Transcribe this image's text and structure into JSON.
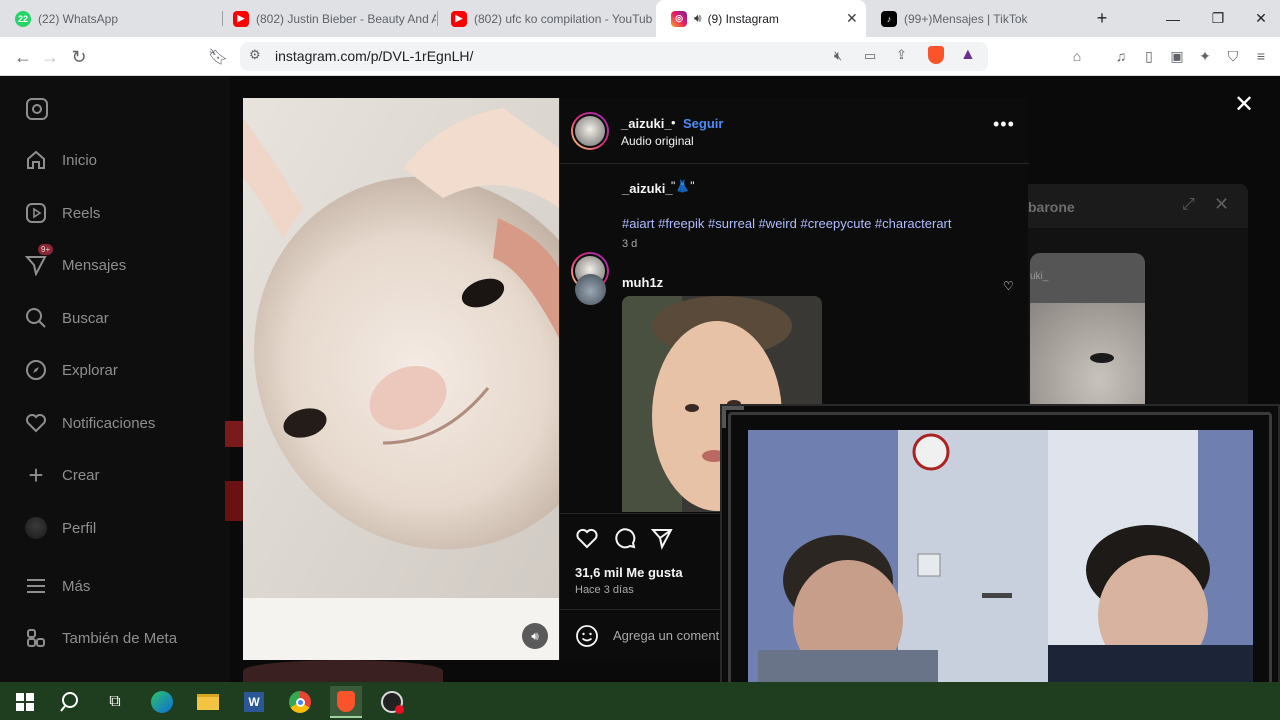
{
  "browser": {
    "tabs": [
      {
        "label": "(22) WhatsApp",
        "icon": "whatsapp-icon",
        "badge": "22"
      },
      {
        "label": "(802) Justin Bieber - Beauty And A",
        "icon": "youtube-icon"
      },
      {
        "label": "(802) ufc ko compilation - YouTub",
        "icon": "youtube-icon"
      },
      {
        "label": "(9) Instagram",
        "icon": "instagram-icon",
        "active": true
      },
      {
        "label": "(99+)Mensajes | TikTok",
        "icon": "tiktok-icon"
      }
    ],
    "url": "instagram.com/p/DVL-1rEgnLH/"
  },
  "sidebar": {
    "items": [
      {
        "label": "Inicio",
        "icon": "home-icon"
      },
      {
        "label": "Reels",
        "icon": "reels-icon"
      },
      {
        "label": "Mensajes",
        "icon": "messages-icon",
        "badge": "9+"
      },
      {
        "label": "Buscar",
        "icon": "search-icon"
      },
      {
        "label": "Explorar",
        "icon": "explore-icon"
      },
      {
        "label": "Notificaciones",
        "icon": "heart-icon"
      },
      {
        "label": "Crear",
        "icon": "plus-icon"
      },
      {
        "label": "Perfil",
        "icon": "avatar-icon"
      },
      {
        "label": "Más",
        "icon": "menu-icon"
      },
      {
        "label": "También de Meta",
        "icon": "meta-icon"
      }
    ]
  },
  "post": {
    "author": "_aizuki_",
    "follow_sep": "•",
    "follow": "Seguir",
    "audio": "Audio original",
    "caption_author": "_aizuki_",
    "caption_emoji": "\"👗\"",
    "hashtags": "#aiart #freepik #surreal #weird #creepycute #characterart",
    "caption_age": "3 d",
    "comment_author": "muh1z",
    "likes": "31,6 mil Me gusta",
    "posted": "Hace 3 días",
    "comment_placeholder": "Agrega un coment"
  },
  "background": {
    "partial_name": "barone",
    "partial_name2": "uki_"
  },
  "colors": {
    "accent": "#4a8df8",
    "hashtag": "#b0bcff",
    "taskbar": "#1f3d1f"
  }
}
